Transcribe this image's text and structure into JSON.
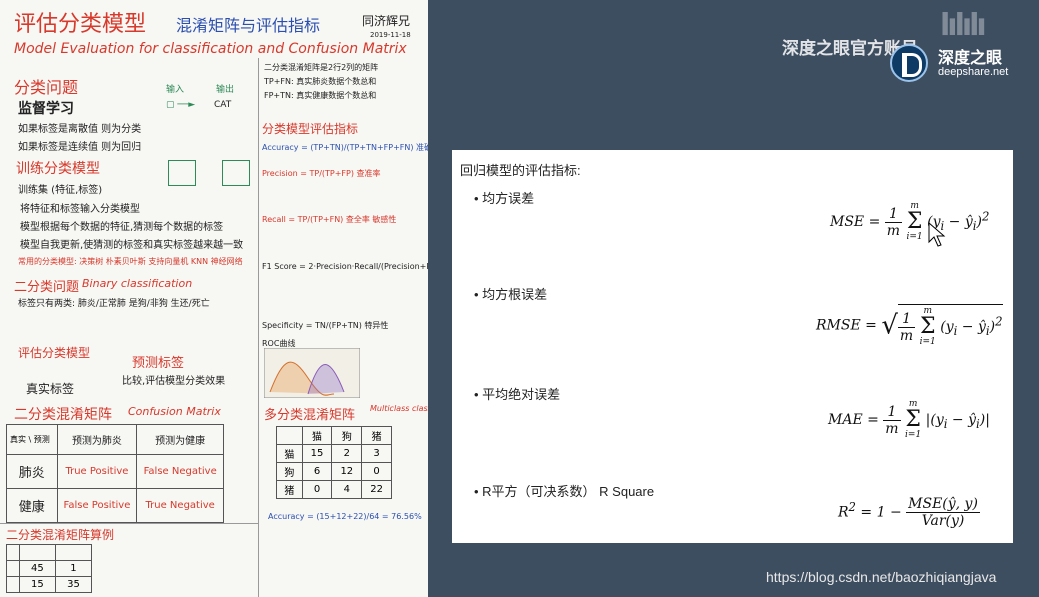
{
  "notes": {
    "title": "评估分类模型",
    "title_sub": "混淆矩阵与评估指标",
    "author": "同济辉兄",
    "date": "2019-11-18",
    "english_title": "Model Evaluation for classification and Confusion Matrix",
    "sec_classification": "分类问题",
    "supervised": "监督学习",
    "label_input": "输入",
    "label_output": "输出",
    "cat": "CAT",
    "line_discrete": "如果标签是离散值 则为分类",
    "line_continuous": "如果标签是连续值 则为回归",
    "sec_train": "训练分类模型",
    "train_set": "训练集 (特征,标签)",
    "train_line1": "将特征和标签输入分类模型",
    "train_line2": "模型根据每个数据的特征,猜测每个数据的标签",
    "train_line3": "模型自我更新,使猜测的标签和真实标签越来越一致",
    "common_models": "常用的分类模型: 决策树 朴素贝叶斯 支持向量机 KNN 神经网络",
    "sec_binary": "二分类问题",
    "binary_en": "Binary classification",
    "binary_desc": "标签只有两类: 肺炎/正常肺 是狗/非狗 生还/死亡",
    "sec_eval_model": "评估分类模型",
    "predicted_label": "预测标签",
    "true_label": "真实标签",
    "compare_line": "比较,评估模型分类效果",
    "sec_binary_cm": "二分类混淆矩阵",
    "cm_en": "Confusion Matrix",
    "cm_corner_pred": "预测",
    "cm_corner_true": "真实",
    "cm_col1": "预测为肺炎",
    "cm_col2": "预测为健康",
    "cm_row1": "肺炎",
    "cm_row2": "健康",
    "tp": "True Positive",
    "fn": "False Negative",
    "fp": "False Positive",
    "tn": "True Negative",
    "sec_example": "二分类混淆矩阵算例",
    "ex_row1": [
      "45",
      "1"
    ],
    "ex_row2": [
      "15",
      "35"
    ],
    "cm_desc_title": "二分类混淆矩阵是2行2列的矩阵",
    "tp_tn_line": "TP+FN: 真实肺炎数据个数总和",
    "fp_tn_line": "FP+TN: 真实健康数据个数总和",
    "sec_metrics": "分类模型评估指标",
    "accuracy": "Accuracy = (TP+TN)/(TP+TN+FP+FN) 准确率",
    "precision": "Precision = TP/(TP+FP) 查准率",
    "recall": "Recall = TP/(TP+FN) 查全率 敏感性",
    "f1": "F1 Score = 2·Precision·Recall/(Precision+Recall)",
    "specificity": "Specificity = TN/(FP+TN) 特异性",
    "roc": "ROC曲线",
    "sec_multi": "多分类混淆矩阵",
    "multi_en": "Multiclass classification",
    "multi_cols": [
      "猫",
      "狗",
      "猪"
    ],
    "multi_rows": [
      {
        "label": "猫",
        "values": [
          "15",
          "2",
          "3"
        ]
      },
      {
        "label": "狗",
        "values": [
          "6",
          "12",
          "0"
        ]
      },
      {
        "label": "猪",
        "values": [
          "0",
          "4",
          "22"
        ]
      }
    ],
    "accuracy_multi": "Accuracy = (15+12+22)/64 = 76.56%"
  },
  "slide": {
    "heading": "回归模型的评估指标:",
    "bullets": [
      {
        "label": "均方误差",
        "formula_name": "MSE"
      },
      {
        "label": "均方根误差",
        "formula_name": "RMSE"
      },
      {
        "label": "平均绝对误差",
        "formula_name": "MAE"
      },
      {
        "label": "R平方（可决系数） R Square",
        "formula_name": "R²"
      }
    ]
  },
  "overlay": {
    "brand": "深度之眼官方账号",
    "brand_cn": "深度之眼",
    "brand_en": "deepshare.net",
    "footer": "https://blog.csdn.net/baozhiqiangjava"
  }
}
